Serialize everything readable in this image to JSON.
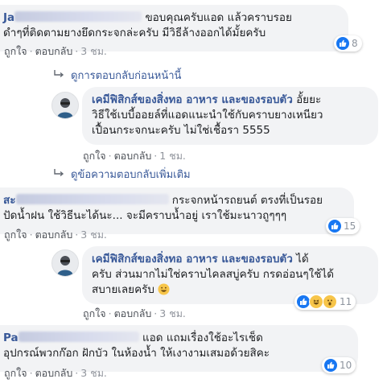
{
  "comments": [
    {
      "name_visible": "Ja",
      "line1": "ขอบคุณครับแอด แล้วคราบรอย",
      "line2": "ดำๆที่ติดตามยางยึดกระจกล่ะครับ มีวิธีล้างออกได้มั้ยครับ",
      "like": "ถูกใจ",
      "reply": "ตอบกลับ",
      "time": "3 ชม.",
      "reactions": "8"
    },
    {
      "name": "เคมีฟิสิกส์ของสิ่งทอ อาหาร และของรอบตัว",
      "line1_suffix": "อั้ยยะ",
      "line2": "วิธีใช้เบบี้ออยล์ที่แอดแนะนำใช้กับคราบยางเหนียว",
      "line3": "เปื้อนกระจกนะครับ ไม่ใช่เชื้อรา 5555",
      "like": "ถูกใจ",
      "reply": "ตอบกลับ",
      "time": "1 ชม."
    },
    {
      "name_visible": "สะ",
      "line1": "กระจกหน้ารถยนต์ ตรงที่เป็นรอย",
      "line2": "ปัดน้ำฝน ใช้วิธีนะได้นะ... จะมีคราบน้ำอยู่ เราใช้มะนาวถูๆๆๆ",
      "like": "ถูกใจ",
      "reply": "ตอบกลับ",
      "time": "3 ชม.",
      "reactions": "15"
    },
    {
      "name": "เคมีฟิสิกส์ของสิ่งทอ อาหาร และของรอบตัว",
      "line1_suffix": "ได้",
      "line2": "ครับ ส่วนมากไม่ใช่คราบไคลสบู่ครับ กรดอ่อนๆใช้ได้",
      "line3": "สบายเลยครับ",
      "like": "ถูกใจ",
      "reply": "ตอบกลับ",
      "time": "3 ชม.",
      "reactions": "11"
    },
    {
      "name_visible": "Pa",
      "line1": "แอด แถมเรื่องใช้อะไรเช็ด",
      "line2": "อุปกรณ์พวกก๊อก ฝักบัว ในห้องน้ำ ให้เงางามเสมอด้วยสิคะ",
      "like": "ถูกใจ",
      "reply": "ตอบกลับ",
      "time": "3 ชม.",
      "reactions": "10"
    }
  ],
  "view_previous_replies": "ดูการตอบกลับก่อนหน้านี้",
  "view_more_replies": "ดูข้อความตอบกลับเพิ่มเติม",
  "colors": {
    "link": "#385898",
    "bubble": "#f2f3f5",
    "like_blue": "#1877f2"
  }
}
